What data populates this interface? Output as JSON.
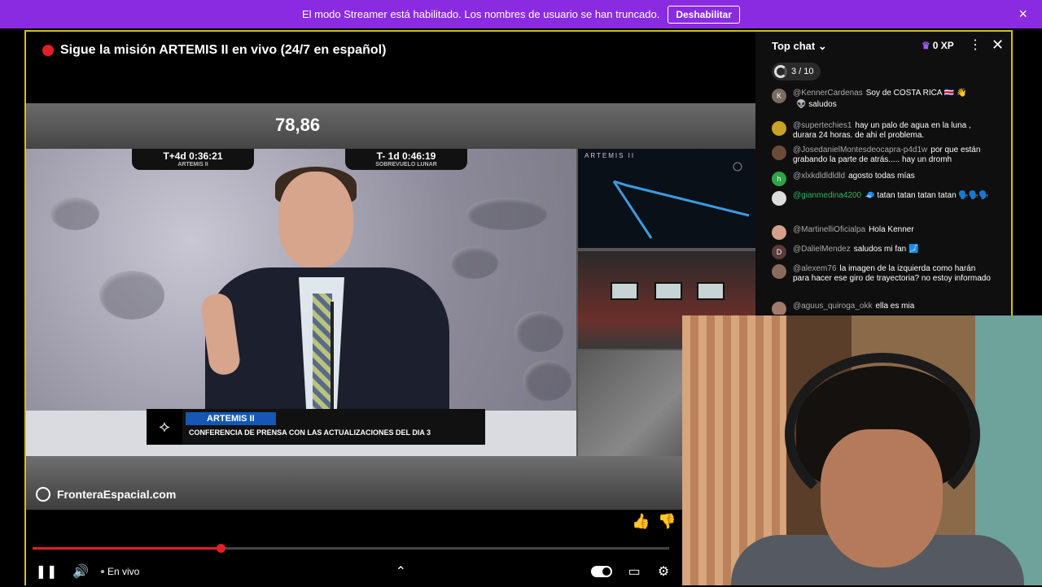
{
  "banner": {
    "message": "El modo Streamer está habilitado. Los nombres de usuario se han truncado.",
    "button_label": "Deshabilitar",
    "close_icon": "×"
  },
  "player": {
    "title": "Sigue la misión ARTEMIS II en vivo (24/7 en español)",
    "counter": "78,86",
    "clock_left": {
      "time": "T+4d 0:36:21",
      "caption": "ARTEMIS II"
    },
    "clock_right": {
      "time": "T- 1d 0:46:19",
      "caption": "SOBREVUELO LUNAR"
    },
    "lower_third": {
      "tag": "ARTEMIS II",
      "subtitle": "CONFERENCIA DE PRENSA CON LAS ACTUALIZACIONES DEL DIA 3"
    },
    "side_feed_label": "ARTEMIS II",
    "watermark": "FronteraEspacial.com",
    "progress": 0.295,
    "live_label": "En vivo",
    "colors": {
      "live": "#e21f26",
      "banner": "#8a2be2",
      "frame": "#c8c800"
    }
  },
  "chat": {
    "header": "Top chat",
    "xp": "0 XP",
    "goal": "3 / 10",
    "messages": [
      {
        "author": "@KennerCardenas",
        "text": "Soy de COSTA RICA 🇨🇷 👋",
        "initial": "K",
        "color": "#7a6a60"
      },
      {
        "author": "",
        "text": "👽 saludos",
        "initial": "",
        "color": "transparent"
      },
      {
        "author": "@supertechies1",
        "text": "hay un palo de agua en la luna , durara 24 horas. de ahi el problema.",
        "initial": "",
        "color": "#c9a227"
      },
      {
        "author": "@JosedanielMontesdeocapra-p4d1w",
        "text": "por que están grabando la parte de atrás..... hay un dromh",
        "initial": "",
        "color": "#6a4a3a"
      },
      {
        "author": "@xlxkdldldldld",
        "text": "agosto todas mías",
        "initial": "h",
        "color": "#2fa34a"
      },
      {
        "author": "@gianmedina4200",
        "text": "🧢 tatan tatan tatan tatan 🗣️🗣️🗣️",
        "initial": "",
        "color": "#dddddd",
        "green": true
      },
      {
        "author": "@MartinelliOficialpa",
        "text": "Hola Kenner",
        "initial": "",
        "color": "#d4a08a"
      },
      {
        "author": "@DalielMendez",
        "text": "saludos mi fan 🗾",
        "initial": "D",
        "color": "#5a3a3a"
      },
      {
        "author": "@alexem76",
        "text": "la imagen de la izquierda como harán para hacer ese giro de trayectoria? no estoy informado",
        "initial": "",
        "color": "#8a6a5a"
      },
      {
        "author": "@aguus_quiroga_okk",
        "text": "ella es mia",
        "initial": "",
        "color": "#a07a6a"
      }
    ]
  }
}
